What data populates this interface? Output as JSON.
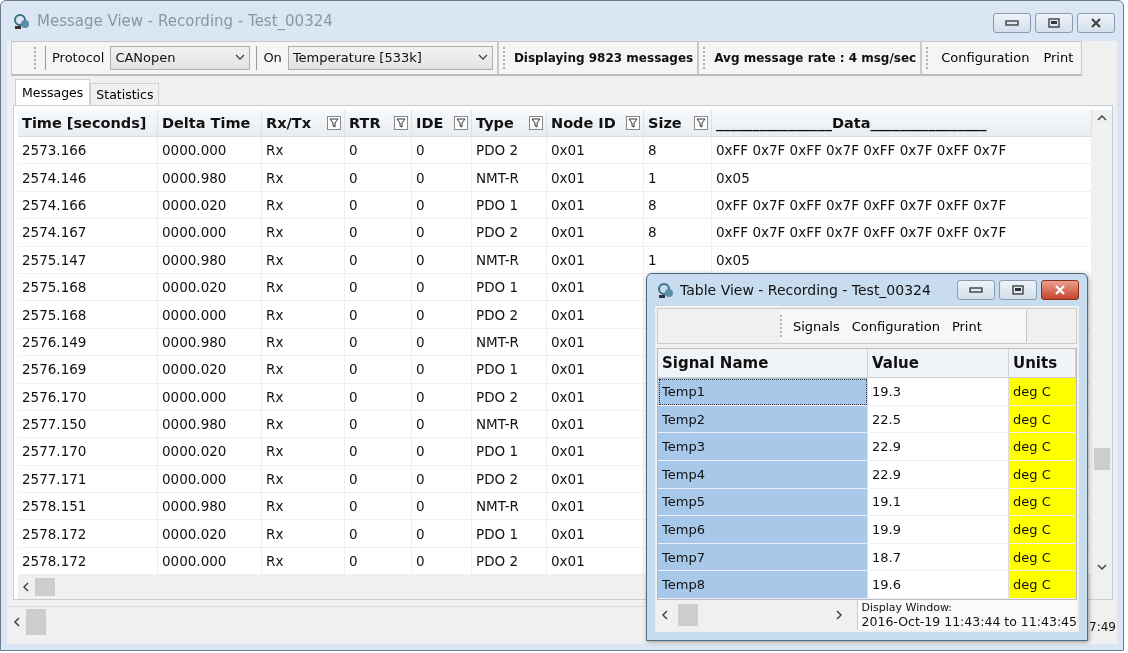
{
  "window": {
    "title": "Message View - Recording - Test_00324"
  },
  "toolbar": {
    "protocol_label": "Protocol",
    "protocol": "CANopen",
    "on_label": "On",
    "source": "Temperature [533k]",
    "message_count": "Displaying 9823 messages",
    "message_rate": "Avg message rate : 4 msg/sec",
    "buttons": [
      "Configuration",
      "Print"
    ]
  },
  "tabs": [
    {
      "label": "Messages",
      "selected": true
    },
    {
      "label": "Statistics",
      "selected": false
    }
  ],
  "table": {
    "columns": [
      {
        "label": "Time [seconds]",
        "filter": false
      },
      {
        "label": "Delta Time",
        "filter": false
      },
      {
        "label": "Rx/Tx",
        "filter": true
      },
      {
        "label": "RTR",
        "filter": true
      },
      {
        "label": "IDE",
        "filter": true
      },
      {
        "label": "Type",
        "filter": true
      },
      {
        "label": "Node ID",
        "filter": true
      },
      {
        "label": "Size",
        "filter": true
      },
      {
        "label": "________________Data________________",
        "filter": false
      }
    ],
    "rows": [
      [
        "2573.166",
        "0000.000",
        "Rx",
        "0",
        "0",
        "PDO 2",
        "0x01",
        "8",
        "0xFF 0x7F 0xFF 0x7F 0xFF 0x7F 0xFF 0x7F"
      ],
      [
        "2574.146",
        "0000.980",
        "Rx",
        "0",
        "0",
        "NMT-R",
        "0x01",
        "1",
        "0x05"
      ],
      [
        "2574.166",
        "0000.020",
        "Rx",
        "0",
        "0",
        "PDO 1",
        "0x01",
        "8",
        "0xFF 0x7F 0xFF 0x7F 0xFF 0x7F 0xFF 0x7F"
      ],
      [
        "2574.167",
        "0000.000",
        "Rx",
        "0",
        "0",
        "PDO 2",
        "0x01",
        "8",
        "0xFF 0x7F 0xFF 0x7F 0xFF 0x7F 0xFF 0x7F"
      ],
      [
        "2575.147",
        "0000.980",
        "Rx",
        "0",
        "0",
        "NMT-R",
        "0x01",
        "1",
        "0x05"
      ],
      [
        "2575.168",
        "0000.020",
        "Rx",
        "0",
        "0",
        "PDO 1",
        "0x01"
      ],
      [
        "2575.168",
        "0000.000",
        "Rx",
        "0",
        "0",
        "PDO 2",
        "0x01"
      ],
      [
        "2576.149",
        "0000.980",
        "Rx",
        "0",
        "0",
        "NMT-R",
        "0x01"
      ],
      [
        "2576.169",
        "0000.020",
        "Rx",
        "0",
        "0",
        "PDO 1",
        "0x01"
      ],
      [
        "2576.170",
        "0000.000",
        "Rx",
        "0",
        "0",
        "PDO 2",
        "0x01"
      ],
      [
        "2577.150",
        "0000.980",
        "Rx",
        "0",
        "0",
        "NMT-R",
        "0x01"
      ],
      [
        "2577.170",
        "0000.020",
        "Rx",
        "0",
        "0",
        "PDO 1",
        "0x01"
      ],
      [
        "2577.171",
        "0000.000",
        "Rx",
        "0",
        "0",
        "PDO 2",
        "0x01"
      ],
      [
        "2578.151",
        "0000.980",
        "Rx",
        "0",
        "0",
        "NMT-R",
        "0x01"
      ],
      [
        "2578.172",
        "0000.020",
        "Rx",
        "0",
        "0",
        "PDO 1",
        "0x01"
      ],
      [
        "2578.172",
        "0000.000",
        "Rx",
        "0",
        "0",
        "PDO 2",
        "0x01"
      ]
    ]
  },
  "table_view": {
    "title": "Table View - Recording - Test_00324",
    "buttons": [
      "Signals",
      "Configuration",
      "Print"
    ],
    "columns": [
      "Signal Name",
      "Value",
      "Units"
    ],
    "rows": [
      {
        "name": "Temp1",
        "value": "19.3",
        "units": "deg C",
        "focused": true
      },
      {
        "name": "Temp2",
        "value": "22.5",
        "units": "deg C",
        "focused": false
      },
      {
        "name": "Temp3",
        "value": "22.9",
        "units": "deg C",
        "focused": false
      },
      {
        "name": "Temp4",
        "value": "22.9",
        "units": "deg C",
        "focused": false
      },
      {
        "name": "Temp5",
        "value": "19.1",
        "units": "deg C",
        "focused": false
      },
      {
        "name": "Temp6",
        "value": "19.9",
        "units": "deg C",
        "focused": false
      },
      {
        "name": "Temp7",
        "value": "18.7",
        "units": "deg C",
        "focused": false
      },
      {
        "name": "Temp8",
        "value": "19.6",
        "units": "deg C",
        "focused": false
      }
    ],
    "display_label": "Display Window:",
    "display_range": "2016-Oct-19 11:43:44 to 11:43:45"
  },
  "status_bar": {
    "text": "7:49"
  }
}
